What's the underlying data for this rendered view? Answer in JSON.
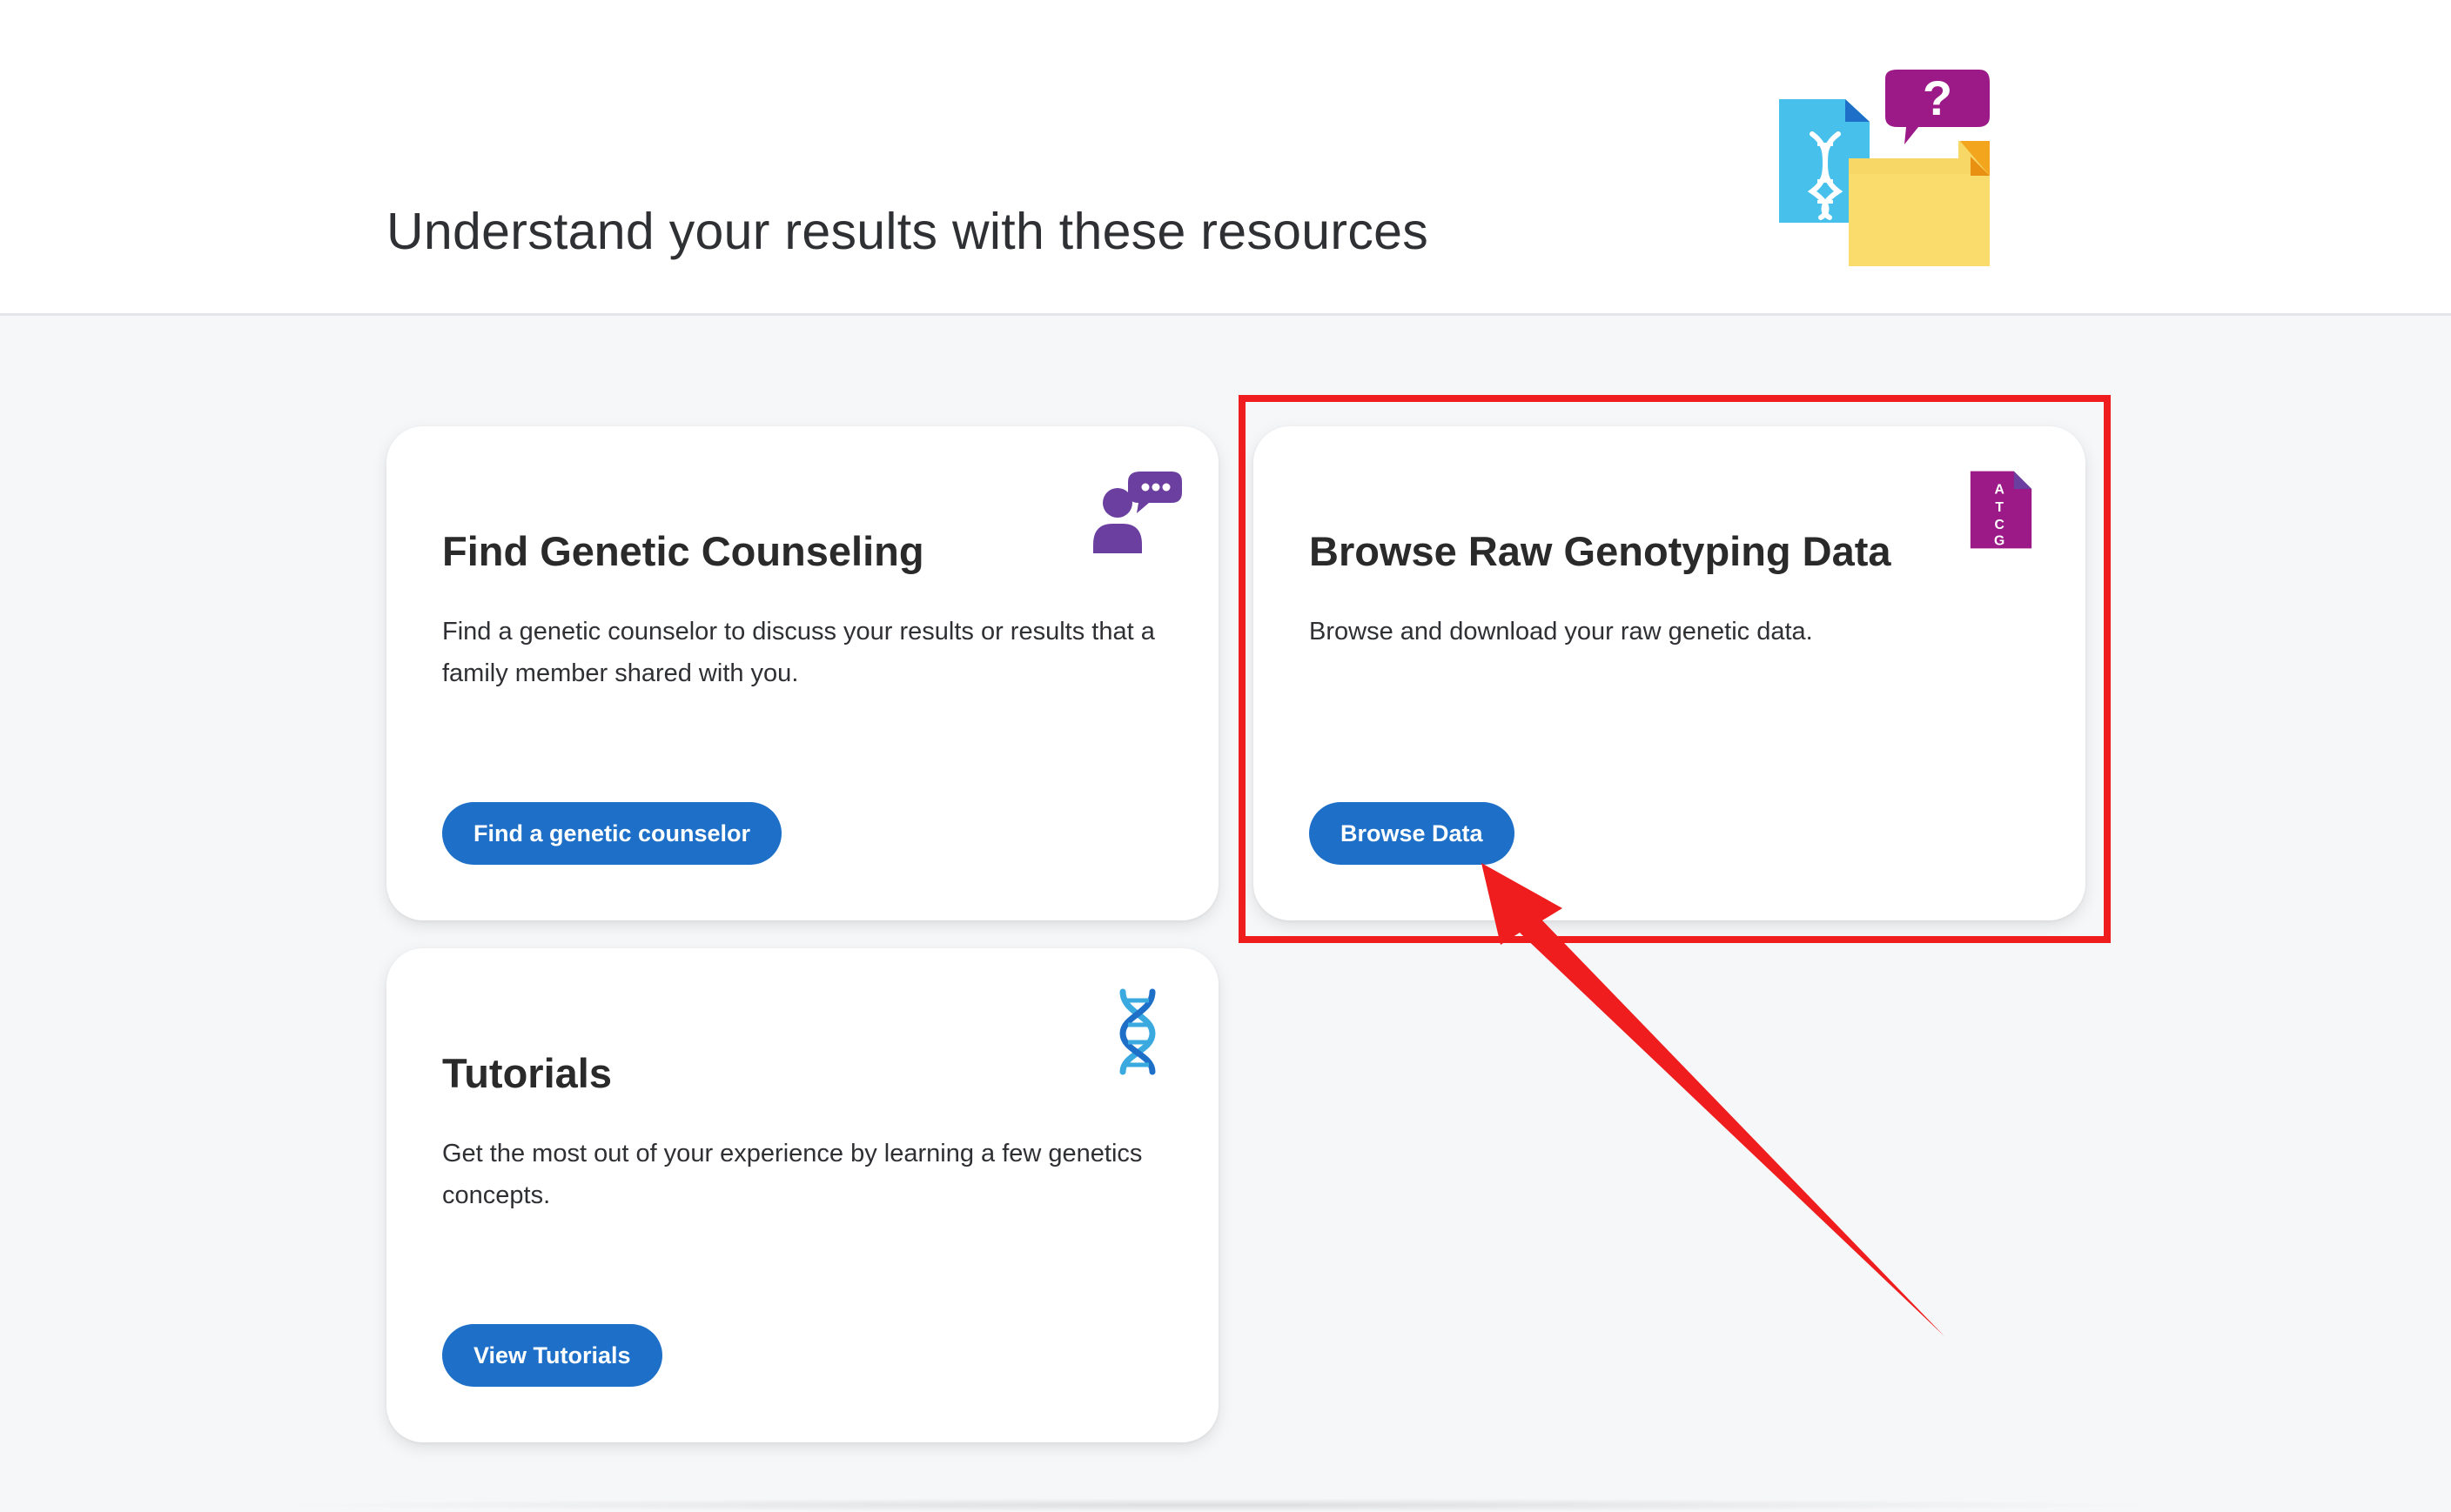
{
  "header": {
    "title": "Understand your results with these resources",
    "illustration_icon": "dna-document-question-folder-icon"
  },
  "cards": {
    "counseling": {
      "title": "Find Genetic Counseling",
      "description": "Find a genetic counselor to discuss your results or results that a family member shared with you.",
      "button_label": "Find a genetic counselor",
      "icon": "counselor-chat-icon"
    },
    "raw_data": {
      "title": "Browse Raw Genotyping Data",
      "description": "Browse and download your raw genetic data.",
      "button_label": "Browse Data",
      "icon": "atcg-file-icon",
      "icon_letters": [
        "A",
        "T",
        "C",
        "G"
      ]
    },
    "tutorials": {
      "title": "Tutorials",
      "description": "Get the most out of your experience by learning a few genetics concepts.",
      "button_label": "View Tutorials",
      "icon": "dna-helix-icon"
    }
  },
  "annotation": {
    "color": "#ef1d1d",
    "target": "Browse Data"
  },
  "colors": {
    "primary_button": "#1d6fc8",
    "background": "#f6f7f9",
    "purple": "#6b3fa0",
    "magenta": "#9c1a87",
    "dna_blue": "#3aa9e0",
    "folder_yellow": "#f7d766"
  }
}
